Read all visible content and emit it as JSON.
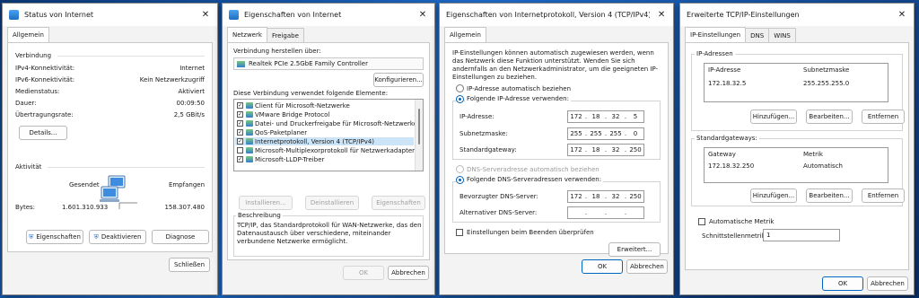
{
  "status_window": {
    "title": "Status von Internet",
    "tab": "Allgemein",
    "connection_header": "Verbindung",
    "rows": [
      {
        "label": "IPv4-Konnektivität:",
        "value": "Internet"
      },
      {
        "label": "IPv6-Konnektivität:",
        "value": "Kein Netzwerkzugriff"
      },
      {
        "label": "Medienstatus:",
        "value": "Aktiviert"
      },
      {
        "label": "Dauer:",
        "value": "00:09:50"
      },
      {
        "label": "Übertragungsrate:",
        "value": "2,5 GBit/s"
      }
    ],
    "details_button": "Details...",
    "activity_header": "Aktivität",
    "sent_label": "Gesendet",
    "received_label": "Empfangen",
    "bytes_label": "Bytes:",
    "bytes_sent": "1.601.310.933",
    "bytes_received": "158.307.480",
    "properties_button": "Eigenschaften",
    "disable_button": "Deaktivieren",
    "diagnose_button": "Diagnose",
    "close_button": "Schließen"
  },
  "props_window": {
    "title": "Eigenschaften von Internet",
    "tabs": [
      "Netzwerk",
      "Freigabe"
    ],
    "connect_using_label": "Verbindung herstellen über:",
    "adapter": "Realtek PCIe 2.5GbE Family Controller",
    "configure_button": "Konfigurieren...",
    "elements_label": "Diese Verbindung verwendet folgende Elemente:",
    "elements": [
      {
        "label": "Client für Microsoft-Netzwerke",
        "checked": true
      },
      {
        "label": "VMware Bridge Protocol",
        "checked": true
      },
      {
        "label": "Datei- und Druckerfreigabe für Microsoft-Netzwerke",
        "checked": true
      },
      {
        "label": "QoS-Paketplaner",
        "checked": true
      },
      {
        "label": "Internetprotokoll, Version 4 (TCP/IPv4)",
        "checked": true
      },
      {
        "label": "Microsoft-Multiplexorprotokoll für Netzwerkadapter",
        "checked": false
      },
      {
        "label": "Microsoft-LLDP-Treiber",
        "checked": true
      }
    ],
    "install_button": "Installieren...",
    "uninstall_button": "Deinstallieren",
    "properties_button": "Eigenschaften",
    "description_header": "Beschreibung",
    "description": "TCP/IP, das Standardprotokoll für WAN-Netzwerke, das den Datenaustausch über verschiedene, miteinander verbundene Netzwerke ermöglicht.",
    "ok_button": "OK",
    "cancel_button": "Abbrechen"
  },
  "ipv4_window": {
    "title": "Eigenschaften von Internetprotokoll, Version 4 (TCP/IPv4)",
    "tab": "Allgemein",
    "intro": "IP-Einstellungen können automatisch zugewiesen werden, wenn das Netzwerk diese Funktion unterstützt. Wenden Sie sich andernfalls an den Netzwerkadministrator, um die geeigneten IP-Einstellungen zu beziehen.",
    "auto_ip_label": "IP-Adresse automatisch beziehen",
    "manual_ip_label": "Folgende IP-Adresse verwenden:",
    "ip_label": "IP-Adresse:",
    "ip": [
      "172",
      "18",
      "32",
      "5"
    ],
    "subnet_label": "Subnetzmaske:",
    "subnet": [
      "255",
      "255",
      "255",
      "0"
    ],
    "gateway_label": "Standardgateway:",
    "gateway": [
      "172",
      "18",
      "32",
      "250"
    ],
    "auto_dns_label": "DNS-Serveradresse automatisch beziehen",
    "manual_dns_label": "Folgende DNS-Serveradressen verwenden:",
    "pref_dns_label": "Bevorzugter DNS-Server:",
    "pref_dns": [
      "172",
      "18",
      "32",
      "250"
    ],
    "alt_dns_label": "Alternativer DNS-Server:",
    "alt_dns": [
      "",
      "",
      "",
      ""
    ],
    "validate_label": "Einstellungen beim Beenden überprüfen",
    "advanced_button": "Erweitert...",
    "ok_button": "OK",
    "cancel_button": "Abbrechen"
  },
  "adv_window": {
    "title": "Erweiterte TCP/IP-Einstellungen",
    "tabs": [
      "IP-Einstellungen",
      "DNS",
      "WINS"
    ],
    "ip_group": "IP-Adressen",
    "ip_col": "IP-Adresse",
    "mask_col": "Subnetzmaske",
    "ip_value": "172.18.32.5",
    "mask_value": "255.255.255.0",
    "gw_group": "Standardgateways:",
    "gw_col": "Gateway",
    "metric_col": "Metrik",
    "gw_value": "172.18.32.250",
    "metric_value": "Automatisch",
    "add_button": "Hinzufügen...",
    "edit_button": "Bearbeiten...",
    "remove_button": "Entfernen",
    "auto_metric_label": "Automatische Metrik",
    "interface_metric_label": "Schnittstellenmetrik:",
    "interface_metric_value": "1",
    "ok_button": "OK",
    "cancel_button": "Abbrechen"
  }
}
